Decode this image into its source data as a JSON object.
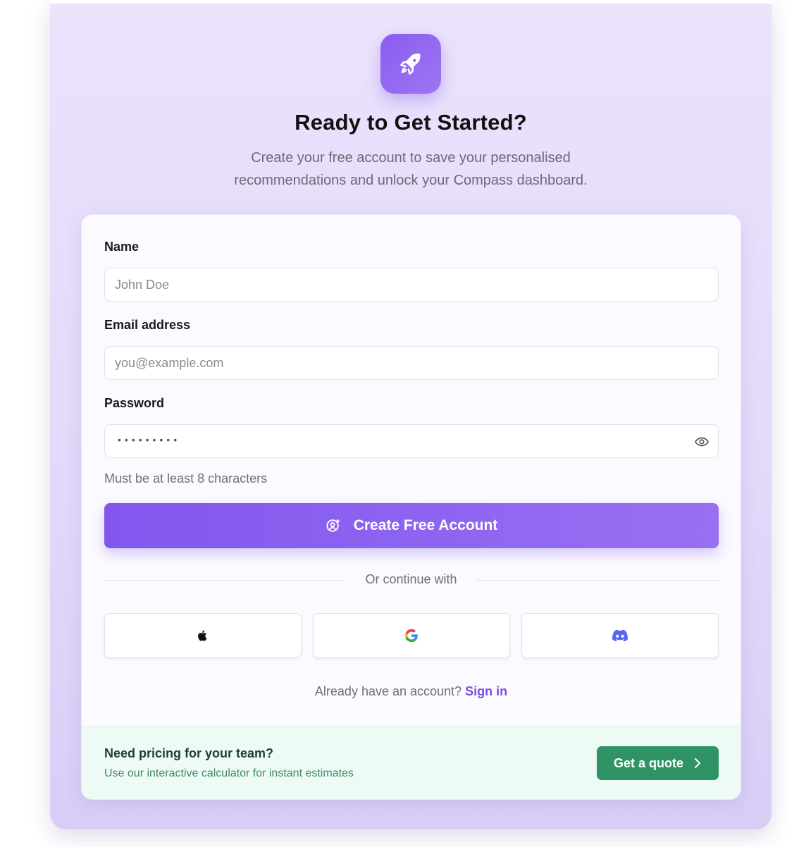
{
  "header": {
    "logo_icon": "rocket-icon",
    "title": "Ready to Get Started?",
    "subtitle": "Create your free account to save your personalised recommendations and unlock your Compass dashboard."
  },
  "form": {
    "name_label": "Name",
    "name_placeholder": "John Doe",
    "email_label": "Email address",
    "email_placeholder": "you@example.com",
    "password_label": "Password",
    "password_mask": "•••••••••",
    "password_hint": "Must be at least 8 characters",
    "submit_label": "Create Free Account"
  },
  "social": {
    "divider_text": "Or continue with",
    "providers": [
      "apple-icon",
      "google-icon",
      "discord-icon"
    ]
  },
  "signin": {
    "prompt": "Already have an account?",
    "link_label": "Sign in"
  },
  "footer": {
    "title": "Need pricing for your team?",
    "subtitle": "Use our interactive calculator for instant estimates",
    "cta_label": "Get a quote"
  },
  "colors": {
    "accent": "#8157ee",
    "link": "#7b4fe0",
    "cta_green": "#2f9366"
  }
}
